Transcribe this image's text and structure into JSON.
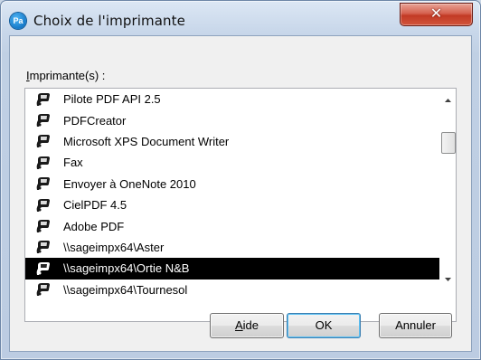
{
  "window": {
    "title": "Choix de l'imprimante",
    "app_icon_text": "Pa",
    "close_glyph": "✕"
  },
  "list": {
    "label_mnemonic": "I",
    "label_rest": "mprimante(s) :",
    "selected_index": 8,
    "items": [
      {
        "name": "Pilote PDF API 2.5",
        "icon": "printer-icon"
      },
      {
        "name": "PDFCreator",
        "icon": "printer-icon"
      },
      {
        "name": "Microsoft XPS Document Writer",
        "icon": "printer-icon"
      },
      {
        "name": "Fax",
        "icon": "printer-icon"
      },
      {
        "name": "Envoyer à OneNote 2010",
        "icon": "printer-icon"
      },
      {
        "name": "CielPDF 4.5",
        "icon": "printer-icon"
      },
      {
        "name": "Adobe PDF",
        "icon": "printer-icon"
      },
      {
        "name": "\\\\sageimpx64\\Aster",
        "icon": "printer-icon"
      },
      {
        "name": "\\\\sageimpx64\\Ortie N&B",
        "icon": "network-printer-icon"
      },
      {
        "name": "\\\\sageimpx64\\Tournesol",
        "icon": "network-printer-icon"
      }
    ]
  },
  "buttons": {
    "help_mnemonic": "A",
    "help_rest": "ide",
    "ok": "OK",
    "cancel": "Annuler"
  }
}
